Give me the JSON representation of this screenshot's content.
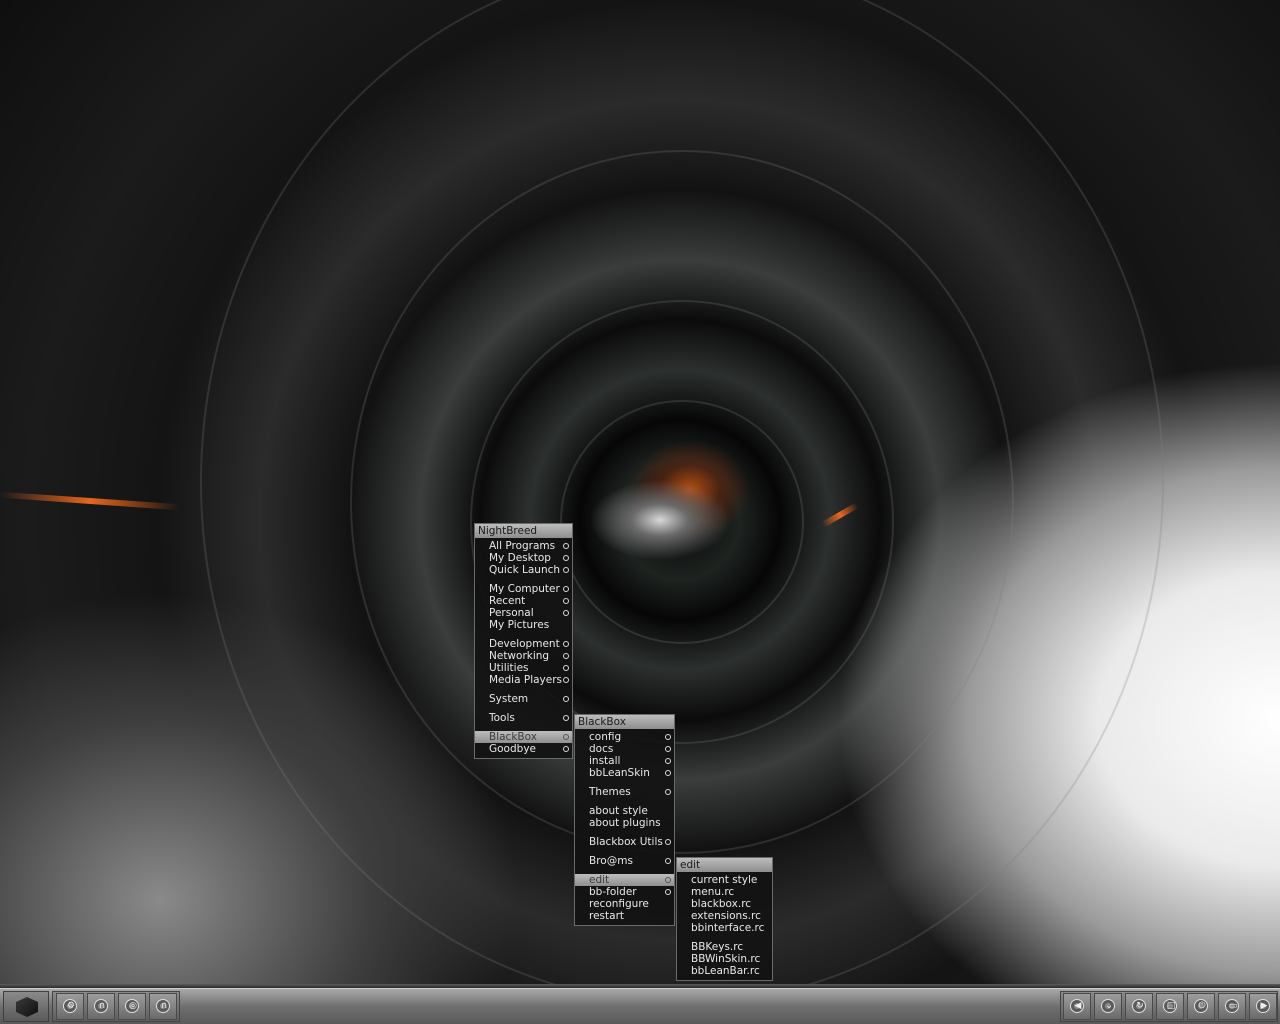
{
  "menus": {
    "root": {
      "title": "NightBreed",
      "items": [
        {
          "label": "All Programs",
          "submenu": true
        },
        {
          "label": "My Desktop",
          "submenu": true
        },
        {
          "label": "Quick Launch",
          "submenu": true
        },
        {
          "separator": true
        },
        {
          "label": "My Computer",
          "submenu": true
        },
        {
          "label": "Recent",
          "submenu": true
        },
        {
          "label": "Personal",
          "submenu": true
        },
        {
          "label": "My Pictures",
          "submenu": false
        },
        {
          "separator": true
        },
        {
          "label": "Development",
          "submenu": true
        },
        {
          "label": "Networking",
          "submenu": true
        },
        {
          "label": "Utilities",
          "submenu": true
        },
        {
          "label": "Media Players",
          "submenu": true
        },
        {
          "separator": true
        },
        {
          "label": "System",
          "submenu": true
        },
        {
          "separator": true
        },
        {
          "label": "Tools",
          "submenu": true
        },
        {
          "separator": true
        },
        {
          "label": "BlackBox",
          "submenu": true,
          "active": true
        },
        {
          "label": "Goodbye",
          "submenu": true
        }
      ]
    },
    "blackbox": {
      "title": "BlackBox",
      "items": [
        {
          "label": "config",
          "submenu": true
        },
        {
          "label": "docs",
          "submenu": true
        },
        {
          "label": "install",
          "submenu": true
        },
        {
          "label": "bbLeanSkin",
          "submenu": true
        },
        {
          "separator": true
        },
        {
          "label": "Themes",
          "submenu": true
        },
        {
          "separator": true
        },
        {
          "label": "about style",
          "submenu": false
        },
        {
          "label": "about plugins",
          "submenu": false
        },
        {
          "separator": true
        },
        {
          "label": "Blackbox Utils",
          "submenu": true
        },
        {
          "separator": true
        },
        {
          "label": "Bro@ms",
          "submenu": true
        },
        {
          "separator": true
        },
        {
          "label": "edit",
          "submenu": true,
          "active": true
        },
        {
          "label": "bb-folder",
          "submenu": true
        },
        {
          "label": "reconfigure",
          "submenu": false
        },
        {
          "label": "restart",
          "submenu": false
        }
      ]
    },
    "edit": {
      "title": "edit",
      "items": [
        {
          "label": "current style",
          "submenu": false
        },
        {
          "label": "menu.rc",
          "submenu": false
        },
        {
          "label": "blackbox.rc",
          "submenu": false
        },
        {
          "label": "extensions.rc",
          "submenu": false
        },
        {
          "label": "bbinterface.rc",
          "submenu": false
        },
        {
          "separator": true
        },
        {
          "label": "BBKeys.rc",
          "submenu": false
        },
        {
          "label": "BBWinSkin.rc",
          "submenu": false
        },
        {
          "label": "bbLeanBar.rc",
          "submenu": false
        }
      ]
    }
  },
  "taskbar": {
    "start_icon": "blackbox-cube-icon",
    "left_buttons": [
      {
        "name": "gear-icon",
        "glyph": "⚙"
      },
      {
        "name": "arch-icon",
        "glyph": "∩"
      },
      {
        "name": "target-icon",
        "glyph": "◎"
      },
      {
        "name": "headphones-icon",
        "glyph": "∩"
      }
    ],
    "right_buttons": [
      {
        "name": "rewind-icon",
        "glyph": "◀"
      },
      {
        "name": "down-chevron-icon",
        "glyph": "⌄"
      },
      {
        "name": "refresh-icon",
        "glyph": "↻"
      },
      {
        "name": "window-icon",
        "glyph": "□"
      },
      {
        "name": "power-icon",
        "glyph": "⏻"
      },
      {
        "name": "monitor-icon",
        "glyph": "▭"
      },
      {
        "name": "play-forward-icon",
        "glyph": "▶"
      }
    ]
  }
}
